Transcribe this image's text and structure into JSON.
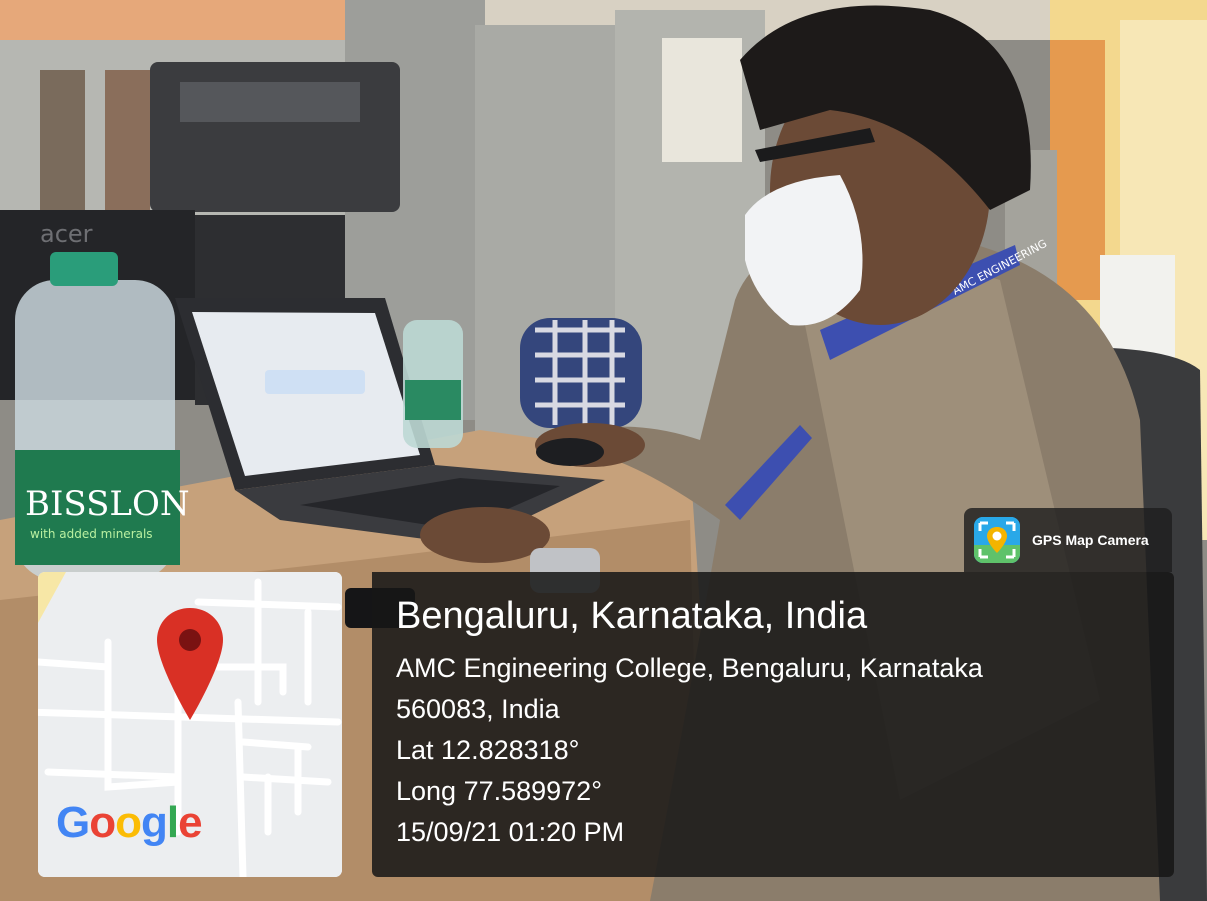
{
  "app_badge": {
    "name": "GPS Map Camera",
    "icon": "camera-pin-icon"
  },
  "map": {
    "logo_letters": [
      "G",
      "o",
      "o",
      "g",
      "l",
      "e"
    ],
    "logo_colors": [
      "#4285F4",
      "#EA4335",
      "#FBBC05",
      "#4285F4",
      "#34A853",
      "#EA4335"
    ],
    "pin_color": "#d93025"
  },
  "location": {
    "title": "Bengaluru, Karnataka, India",
    "address_line1": "AMC Engineering College, Bengaluru, Karnataka",
    "address_line2": "560083, India",
    "lat": "Lat 12.828318°",
    "long": "Long 77.589972°",
    "datetime": "15/09/21 01:20 PM"
  },
  "scene_text": {
    "monitor_brand": "acer",
    "bottle_label": "BISSLON",
    "bottle_sublabel": "with added minerals",
    "lanyard_text": "AMC ENGINEERING"
  }
}
